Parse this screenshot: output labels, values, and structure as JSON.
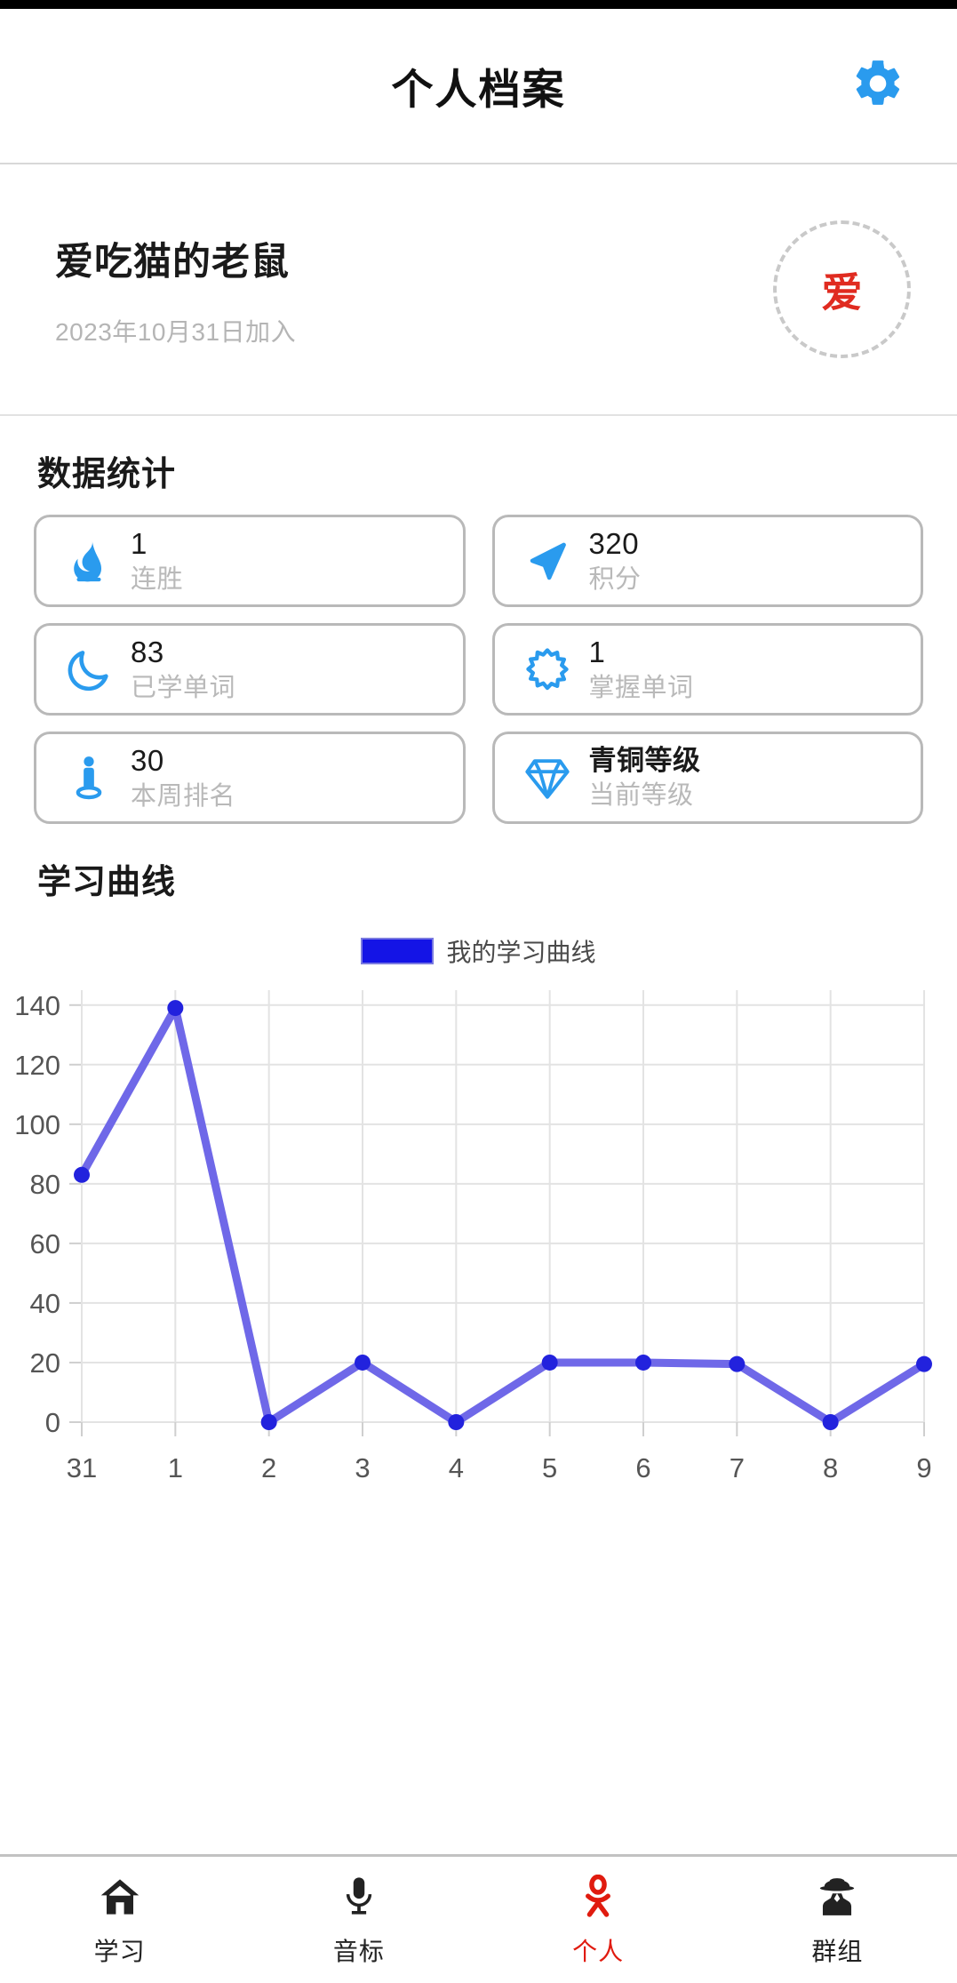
{
  "header": {
    "title": "个人档案",
    "settings_icon": "gear-icon"
  },
  "profile": {
    "name": "爱吃猫的老鼠",
    "joined": "2023年10月31日加入",
    "avatar_initial": "爱",
    "avatar_initial_color": "#e02b20"
  },
  "stats": {
    "section_title": "数据统计",
    "items": [
      {
        "icon": "flame-icon",
        "value": "1",
        "label": "连胜",
        "emphasis": false
      },
      {
        "icon": "navigation-arrow-icon",
        "value": "320",
        "label": "积分",
        "emphasis": false
      },
      {
        "icon": "moon-icon",
        "value": "83",
        "label": "已学单词",
        "emphasis": false
      },
      {
        "icon": "sun-burst-icon",
        "value": "1",
        "label": "掌握单词",
        "emphasis": false
      },
      {
        "icon": "person-pin-icon",
        "value": "30",
        "label": "本周排名",
        "emphasis": false
      },
      {
        "icon": "diamond-icon",
        "value": "青铜等级",
        "label": "当前等级",
        "emphasis": true
      }
    ],
    "icon_color": "#2a9bee",
    "border_color": "#b9b9b9"
  },
  "chart_section": {
    "title": "学习曲线"
  },
  "chart_data": {
    "type": "line",
    "title": "",
    "legend": [
      {
        "name": "我的学习曲线",
        "color": "#1414e6"
      }
    ],
    "legend_position": "top-center",
    "x": [
      "31",
      "1",
      "2",
      "3",
      "4",
      "5",
      "6",
      "7",
      "8",
      "9"
    ],
    "xlabel": "",
    "ylabel": "",
    "ylim": [
      0,
      145
    ],
    "yticks": [
      0,
      20,
      40,
      60,
      80,
      100,
      120,
      140
    ],
    "grid": true,
    "line_color": "#6f68e8",
    "marker_color": "#2222dd",
    "series": [
      {
        "name": "我的学习曲线",
        "values": [
          83,
          139,
          0,
          20,
          0,
          20,
          20,
          19.5,
          0,
          19.5
        ]
      }
    ]
  },
  "bottom_nav": {
    "items": [
      {
        "icon": "home-icon",
        "label": "学习",
        "active": false
      },
      {
        "icon": "microphone-icon",
        "label": "音标",
        "active": false
      },
      {
        "icon": "person-icon",
        "label": "个人",
        "active": true
      },
      {
        "icon": "detective-icon",
        "label": "群组",
        "active": false
      }
    ],
    "active_color": "#e01b0f"
  }
}
